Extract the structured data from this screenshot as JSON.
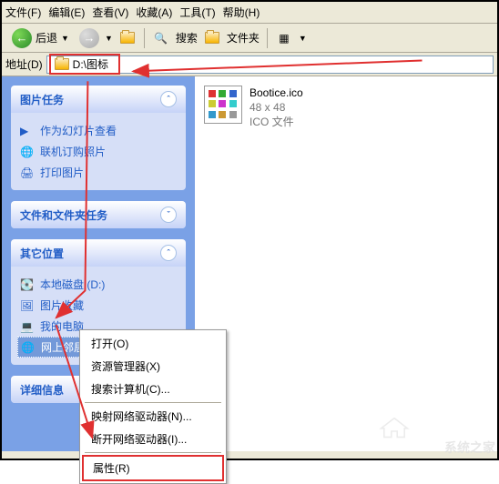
{
  "menus": [
    "文件(F)",
    "编辑(E)",
    "查看(V)",
    "收藏(A)",
    "工具(T)",
    "帮助(H)"
  ],
  "toolbar": {
    "back": "后退",
    "search": "搜索",
    "folders": "文件夹"
  },
  "addr": {
    "label": "地址(D)",
    "path": "D:\\图标"
  },
  "sidebar": {
    "panel1": {
      "title": "图片任务",
      "items": [
        "作为幻灯片查看",
        "联机订购照片",
        "打印图片"
      ]
    },
    "panel2": {
      "title": "文件和文件夹任务"
    },
    "panel3": {
      "title": "其它位置",
      "items": [
        "本地磁盘 (D:)",
        "图片收藏",
        "我的电脑",
        "网上邻居"
      ]
    },
    "panel4": {
      "title": "详细信息"
    }
  },
  "file": {
    "name": "Bootice.ico",
    "dim": "48 x 48",
    "type": "ICO 文件"
  },
  "context": {
    "open": "打开(O)",
    "explorer": "资源管理器(X)",
    "search": "搜索计算机(C)...",
    "map": "映射网络驱动器(N)...",
    "unmap": "断开网络驱动器(I)...",
    "props": "属性(R)"
  },
  "watermark": "系统之家"
}
